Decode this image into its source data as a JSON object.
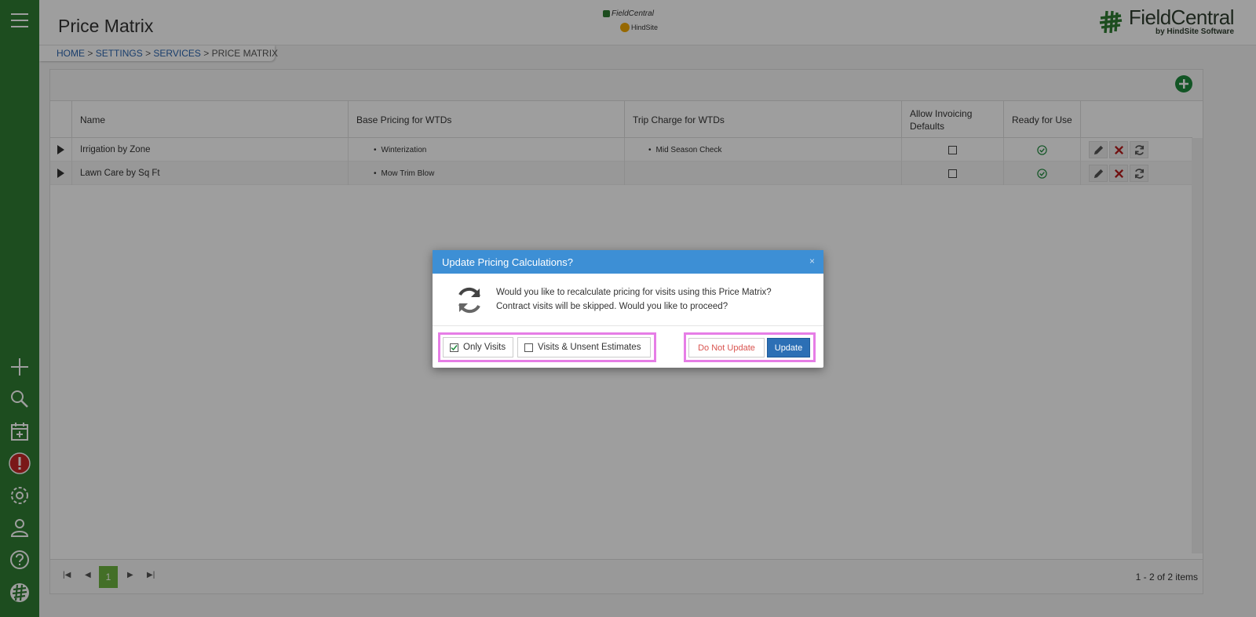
{
  "header": {
    "title": "Price Matrix",
    "center_logo_line1": "FieldCentral",
    "center_logo_line2": "HindSite",
    "brand_name": "FieldCentral",
    "brand_sub": "by HindSite Software"
  },
  "breadcrumb": {
    "items": [
      "HOME",
      "SETTINGS",
      "SERVICES",
      "PRICE MATRIX"
    ],
    "separator": ">"
  },
  "grid": {
    "columns": [
      "Name",
      "Base Pricing for WTDs",
      "Trip Charge for WTDs",
      "Allow Invoicing Defaults",
      "Ready for Use"
    ],
    "rows": [
      {
        "name": "Irrigation by Zone",
        "base_pricing": "Winterization",
        "trip_charge": "Mid Season Check",
        "allow_invoicing": false,
        "ready": true
      },
      {
        "name": "Lawn Care by Sq Ft",
        "base_pricing": "Mow Trim Blow",
        "trip_charge": "",
        "allow_invoicing": false,
        "ready": true
      }
    ]
  },
  "pager": {
    "current_page": "1",
    "info": "1 - 2 of 2 items"
  },
  "modal": {
    "title": "Update Pricing Calculations?",
    "close": "×",
    "message_line1": "Would you like to recalculate pricing for visits using this Price Matrix?",
    "message_line2": "Contract visits will be skipped. Would you like to proceed?",
    "option_only_visits": "Only Visits",
    "option_visits_estimates": "Visits & Unsent Estimates",
    "only_visits_checked": true,
    "visits_estimates_checked": false,
    "btn_do_not_update": "Do Not Update",
    "btn_update": "Update"
  },
  "colors": {
    "sidebar": "#2f7d32",
    "modal_header": "#3d8fd5",
    "update_button": "#2c6fb5",
    "danger_text": "#d9534f",
    "highlight": "#e67ee6",
    "page_active": "#6cb33f",
    "add_button": "#1e8a3c"
  }
}
